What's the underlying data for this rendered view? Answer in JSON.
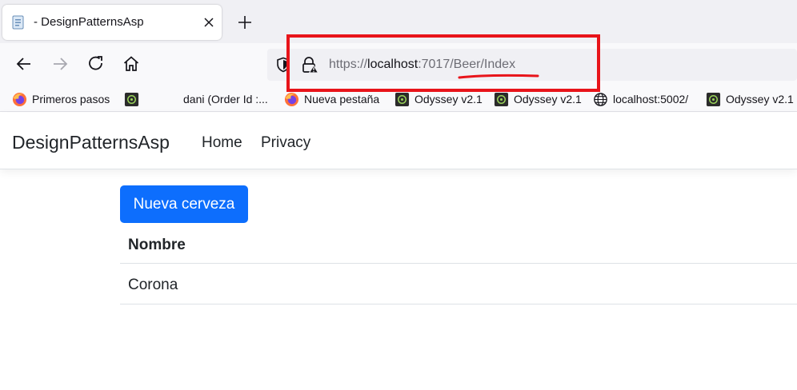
{
  "browser": {
    "tab": {
      "title": "- DesignPatternsAsp"
    },
    "url": {
      "scheme": "https://",
      "host": "localhost",
      "port": ":7017",
      "path": "/Beer/Index"
    },
    "bookmarks": [
      {
        "label": "Primeros pasos",
        "icon": "firefox-icon"
      },
      {
        "label": "",
        "icon": "odyssey-icon"
      },
      {
        "label": "dani (Order Id :...",
        "icon": "none"
      },
      {
        "label": "Nueva pestaña",
        "icon": "firefox-icon"
      },
      {
        "label": "Odyssey v2.1",
        "icon": "odyssey-icon"
      },
      {
        "label": "Odyssey v2.1",
        "icon": "odyssey-icon"
      },
      {
        "label": "localhost:5002/",
        "icon": "globe-icon"
      },
      {
        "label": "Odyssey v2.1",
        "icon": "odyssey-icon"
      }
    ],
    "annotation_color": "#e8141a"
  },
  "site": {
    "brand": "DesignPatternsAsp",
    "nav": [
      "Home",
      "Privacy"
    ],
    "new_button": "Nueva cerveza",
    "table": {
      "header": "Nombre",
      "rows": [
        "Corona"
      ]
    },
    "primary_color": "#0d6efd"
  }
}
